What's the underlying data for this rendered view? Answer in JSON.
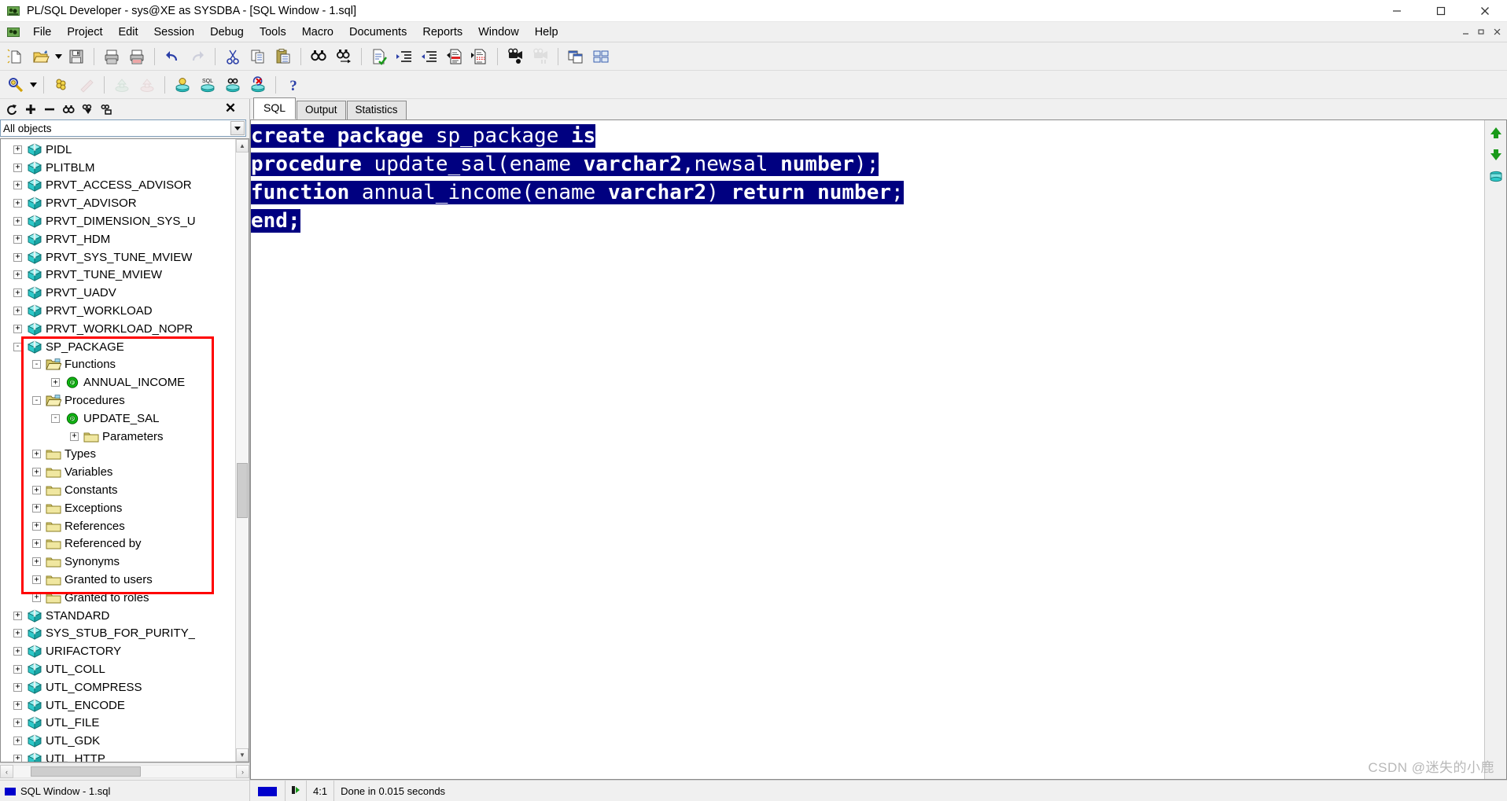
{
  "window": {
    "title": "PL/SQL Developer - sys@XE as SYSDBA - [SQL Window - 1.sql]",
    "app_icon": "plsql-developer-icon",
    "minimize_label": "—",
    "maximize_label": "❐",
    "close_label": "✕",
    "mdi_restore_label": "–",
    "mdi_maximize_label": "❐",
    "mdi_close_label": "✕"
  },
  "menu": {
    "items": [
      {
        "label": "File"
      },
      {
        "label": "Project"
      },
      {
        "label": "Edit"
      },
      {
        "label": "Session"
      },
      {
        "label": "Debug"
      },
      {
        "label": "Tools"
      },
      {
        "label": "Macro"
      },
      {
        "label": "Documents"
      },
      {
        "label": "Reports"
      },
      {
        "label": "Window"
      },
      {
        "label": "Help"
      }
    ]
  },
  "toolbar_top": {
    "buttons": [
      {
        "name": "new-icon",
        "title": "New"
      },
      {
        "name": "open-icon",
        "title": "Open"
      },
      {
        "name": "open-dropdown-icon",
        "title": "Open list"
      },
      {
        "name": "save-icon",
        "title": "Save"
      },
      {
        "name": "print-icon",
        "title": "Print"
      },
      {
        "name": "print-preview-icon",
        "title": "Print preview"
      },
      {
        "name": "undo-icon",
        "title": "Undo"
      },
      {
        "name": "redo-icon",
        "title": "Redo"
      },
      {
        "name": "cut-icon",
        "title": "Cut"
      },
      {
        "name": "copy-icon",
        "title": "Copy"
      },
      {
        "name": "paste-icon",
        "title": "Paste"
      },
      {
        "name": "find-icon",
        "title": "Find"
      },
      {
        "name": "find-next-icon",
        "title": "Find next"
      },
      {
        "name": "check-syntax-icon",
        "title": "Check syntax"
      },
      {
        "name": "indent-icon",
        "title": "Indent"
      },
      {
        "name": "unindent-icon",
        "title": "Unindent"
      },
      {
        "name": "comment-icon",
        "title": "Comment"
      },
      {
        "name": "uncomment-icon",
        "title": "Uncomment"
      },
      {
        "name": "record-macro-icon",
        "title": "Record macro"
      },
      {
        "name": "play-macro-icon",
        "title": "Play macro"
      },
      {
        "name": "copy-window-icon",
        "title": "Copy window"
      },
      {
        "name": "window-list-icon",
        "title": "Window list"
      }
    ]
  },
  "toolbar_second": {
    "buttons": [
      {
        "name": "explain-plan-icon",
        "title": "Explain plan"
      },
      {
        "name": "explain-dropdown-icon",
        "title": "Explain options"
      },
      {
        "name": "beautifier-icon",
        "title": "PL/SQL Beautifier"
      },
      {
        "name": "wand-icon",
        "title": "Wand"
      },
      {
        "name": "import-icon",
        "title": "Import"
      },
      {
        "name": "export-icon",
        "title": "Export"
      },
      {
        "name": "execute-icon",
        "title": "Execute"
      },
      {
        "name": "execute-sql-icon",
        "title": "Execute SQL"
      },
      {
        "name": "find-db-icon",
        "title": "Find in database"
      },
      {
        "name": "break-icon",
        "title": "Break"
      },
      {
        "name": "help-icon",
        "title": "Help"
      }
    ]
  },
  "browser": {
    "toolbar_buttons": [
      {
        "name": "refresh-icon",
        "title": "Refresh"
      },
      {
        "name": "expand-all-icon",
        "title": "Expand all"
      },
      {
        "name": "collapse-all-icon",
        "title": "Collapse all"
      },
      {
        "name": "find-object-icon",
        "title": "Find object"
      },
      {
        "name": "filter-icon",
        "title": "Filter"
      },
      {
        "name": "folder-filter-icon",
        "title": "Folder filter"
      }
    ],
    "close_label": "✕",
    "filter": {
      "value": "All objects",
      "placeholder": "All objects"
    },
    "tree": [
      {
        "indent": 0,
        "expander": "+",
        "icon": "package-icon",
        "label": "PIDL"
      },
      {
        "indent": 0,
        "expander": "+",
        "icon": "package-icon",
        "label": "PLITBLM"
      },
      {
        "indent": 0,
        "expander": "+",
        "icon": "package-icon",
        "label": "PRVT_ACCESS_ADVISOR"
      },
      {
        "indent": 0,
        "expander": "+",
        "icon": "package-icon",
        "label": "PRVT_ADVISOR"
      },
      {
        "indent": 0,
        "expander": "+",
        "icon": "package-icon",
        "label": "PRVT_DIMENSION_SYS_U"
      },
      {
        "indent": 0,
        "expander": "+",
        "icon": "package-icon",
        "label": "PRVT_HDM"
      },
      {
        "indent": 0,
        "expander": "+",
        "icon": "package-icon",
        "label": "PRVT_SYS_TUNE_MVIEW"
      },
      {
        "indent": 0,
        "expander": "+",
        "icon": "package-icon",
        "label": "PRVT_TUNE_MVIEW"
      },
      {
        "indent": 0,
        "expander": "+",
        "icon": "package-icon",
        "label": "PRVT_UADV"
      },
      {
        "indent": 0,
        "expander": "+",
        "icon": "package-icon",
        "label": "PRVT_WORKLOAD"
      },
      {
        "indent": 0,
        "expander": "+",
        "icon": "package-icon",
        "label": "PRVT_WORKLOAD_NOPR"
      },
      {
        "indent": 0,
        "expander": "-",
        "icon": "package-icon",
        "label": "SP_PACKAGE"
      },
      {
        "indent": 1,
        "expander": "-",
        "icon": "folder-open-icon",
        "label": "Functions"
      },
      {
        "indent": 2,
        "expander": "+",
        "icon": "function-icon",
        "label": "ANNUAL_INCOME"
      },
      {
        "indent": 1,
        "expander": "-",
        "icon": "folder-open-icon",
        "label": "Procedures"
      },
      {
        "indent": 2,
        "expander": "-",
        "icon": "procedure-icon",
        "label": "UPDATE_SAL"
      },
      {
        "indent": 3,
        "expander": "+",
        "icon": "folder-icon",
        "label": "Parameters"
      },
      {
        "indent": 1,
        "expander": "+",
        "icon": "folder-icon",
        "label": "Types"
      },
      {
        "indent": 1,
        "expander": "+",
        "icon": "folder-icon",
        "label": "Variables"
      },
      {
        "indent": 1,
        "expander": "+",
        "icon": "folder-icon",
        "label": "Constants"
      },
      {
        "indent": 1,
        "expander": "+",
        "icon": "folder-icon",
        "label": "Exceptions"
      },
      {
        "indent": 1,
        "expander": "+",
        "icon": "folder-icon",
        "label": "References"
      },
      {
        "indent": 1,
        "expander": "+",
        "icon": "folder-icon",
        "label": "Referenced by"
      },
      {
        "indent": 1,
        "expander": "+",
        "icon": "folder-icon",
        "label": "Synonyms"
      },
      {
        "indent": 1,
        "expander": "+",
        "icon": "folder-icon",
        "label": "Granted to users"
      },
      {
        "indent": 1,
        "expander": "+",
        "icon": "folder-icon",
        "label": "Granted to roles"
      },
      {
        "indent": 0,
        "expander": "+",
        "icon": "package-icon",
        "label": "STANDARD"
      },
      {
        "indent": 0,
        "expander": "+",
        "icon": "package-icon",
        "label": "SYS_STUB_FOR_PURITY_"
      },
      {
        "indent": 0,
        "expander": "+",
        "icon": "package-icon",
        "label": "URIFACTORY"
      },
      {
        "indent": 0,
        "expander": "+",
        "icon": "package-icon",
        "label": "UTL_COLL"
      },
      {
        "indent": 0,
        "expander": "+",
        "icon": "package-icon",
        "label": "UTL_COMPRESS"
      },
      {
        "indent": 0,
        "expander": "+",
        "icon": "package-icon",
        "label": "UTL_ENCODE"
      },
      {
        "indent": 0,
        "expander": "+",
        "icon": "package-icon",
        "label": "UTL_FILE"
      },
      {
        "indent": 0,
        "expander": "+",
        "icon": "package-icon",
        "label": "UTL_GDK"
      },
      {
        "indent": 0,
        "expander": "+",
        "icon": "package-icon",
        "label": "UTL_HTTP"
      }
    ],
    "scroll": {
      "up_label": "▲",
      "down_label": "▼",
      "left_label": "‹",
      "right_label": "›"
    }
  },
  "editor": {
    "tabs": [
      {
        "label": "SQL",
        "active": true
      },
      {
        "label": "Output",
        "active": false
      },
      {
        "label": "Statistics",
        "active": false
      }
    ],
    "code_lines": [
      [
        {
          "text": "create package ",
          "bold": true,
          "selected": true
        },
        {
          "text": "sp_package ",
          "bold": false,
          "selected": true
        },
        {
          "text": "is",
          "bold": true,
          "selected": true
        }
      ],
      [
        {
          "text": "procedure ",
          "bold": true,
          "selected": true
        },
        {
          "text": "update_sal(ename ",
          "bold": false,
          "selected": true
        },
        {
          "text": "varchar2",
          "bold": true,
          "selected": true
        },
        {
          "text": ",newsal ",
          "bold": false,
          "selected": true
        },
        {
          "text": "number",
          "bold": true,
          "selected": true
        },
        {
          "text": ");",
          "bold": false,
          "selected": true
        }
      ],
      [
        {
          "text": "function ",
          "bold": true,
          "selected": true
        },
        {
          "text": "annual_income(ename ",
          "bold": false,
          "selected": true
        },
        {
          "text": "varchar2",
          "bold": true,
          "selected": true
        },
        {
          "text": ") ",
          "bold": false,
          "selected": true
        },
        {
          "text": "return number",
          "bold": true,
          "selected": true
        },
        {
          "text": ";",
          "bold": false,
          "selected": true
        }
      ],
      [
        {
          "text": "end;",
          "bold": true,
          "selected": true
        }
      ]
    ],
    "side_icons": [
      {
        "name": "scroll-up-green-icon",
        "title": "Previous statement"
      },
      {
        "name": "scroll-down-green-icon",
        "title": "Next statement"
      },
      {
        "name": "database-green-icon",
        "title": "Session"
      }
    ],
    "selection_color": "#000080",
    "selection_text_color": "#ffffff"
  },
  "statusbar": {
    "document_label": "SQL Window - 1.sql",
    "cursor_position": "4:1",
    "message": "Done in 0.015 seconds"
  },
  "watermark": {
    "text": "CSDN @迷失的小鹿"
  }
}
